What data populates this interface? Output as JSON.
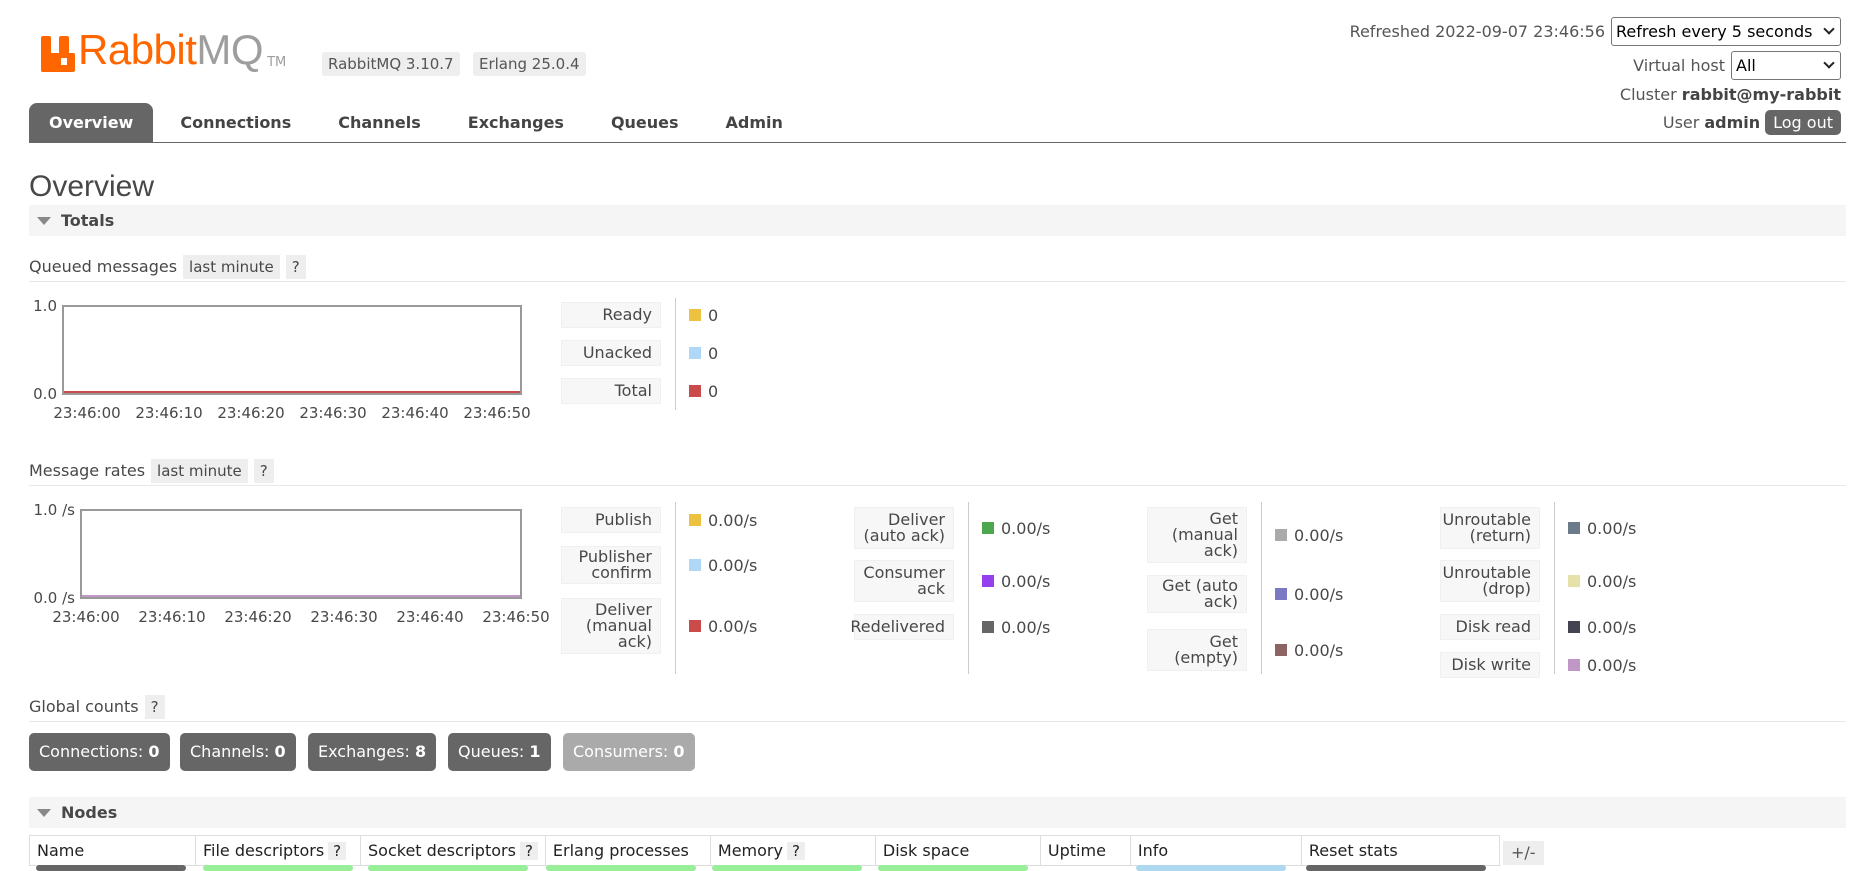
{
  "header": {
    "logo": {
      "brand": "Rabbit",
      "brand2": "MQ",
      "tm": "TM"
    },
    "rabbitmq_version": "RabbitMQ 3.10.7",
    "erlang_version": "Erlang 25.0.4",
    "refreshed_label": "Refreshed 2022-09-07 23:46:56",
    "refresh_select": "Refresh every 5 seconds",
    "vhost_label": "Virtual host",
    "vhost_select": "All",
    "cluster_label": "Cluster",
    "cluster_name": "rabbit@my-rabbit",
    "user_label": "User",
    "user_name": "admin",
    "logout_label": "Log out"
  },
  "tabs": [
    {
      "label": "Overview",
      "active": true
    },
    {
      "label": "Connections"
    },
    {
      "label": "Channels"
    },
    {
      "label": "Exchanges"
    },
    {
      "label": "Queues"
    },
    {
      "label": "Admin"
    }
  ],
  "page_title": "Overview",
  "totals": {
    "section_label": "Totals",
    "queued": {
      "title": "Queued messages",
      "range_label": "last minute",
      "help": "?",
      "series": [
        {
          "label": "Ready",
          "value": "0",
          "color": "#edc240"
        },
        {
          "label": "Unacked",
          "value": "0",
          "color": "#afd8f8"
        },
        {
          "label": "Total",
          "value": "0",
          "color": "#cb4b4b"
        }
      ]
    },
    "rates": {
      "title": "Message rates",
      "range_label": "last minute",
      "help": "?",
      "groups": [
        [
          {
            "label": "Publish",
            "value": "0.00/s",
            "color": "#edc240"
          },
          {
            "label": "Publisher confirm",
            "value": "0.00/s",
            "color": "#afd8f8"
          },
          {
            "label": "Deliver (manual ack)",
            "value": "0.00/s",
            "color": "#cb4b4b"
          }
        ],
        [
          {
            "label": "Deliver (auto ack)",
            "value": "0.00/s",
            "color": "#4da74d"
          },
          {
            "label": "Consumer ack",
            "value": "0.00/s",
            "color": "#9440ed"
          },
          {
            "label": "Redelivered",
            "value": "0.00/s",
            "color": "#666666"
          }
        ],
        [
          {
            "label": "Get (manual ack)",
            "value": "0.00/s",
            "color": "#aaaaaa"
          },
          {
            "label": "Get (auto ack)",
            "value": "0.00/s",
            "color": "#7c79c3"
          },
          {
            "label": "Get (empty)",
            "value": "0.00/s",
            "color": "#8d6363"
          }
        ],
        [
          {
            "label": "Unroutable (return)",
            "value": "0.00/s",
            "color": "#6b7b8b"
          },
          {
            "label": "Unroutable (drop)",
            "value": "0.00/s",
            "color": "#e4e2a8"
          },
          {
            "label": "Disk read",
            "value": "0.00/s",
            "color": "#444450"
          },
          {
            "label": "Disk write",
            "value": "0.00/s",
            "color": "#bf98c5"
          }
        ]
      ]
    },
    "global_counts": {
      "title": "Global counts",
      "help": "?",
      "items": [
        {
          "label": "Connections:",
          "value": "0"
        },
        {
          "label": "Channels:",
          "value": "0"
        },
        {
          "label": "Exchanges:",
          "value": "8"
        },
        {
          "label": "Queues:",
          "value": "1"
        },
        {
          "label": "Consumers:",
          "value": "0"
        }
      ]
    }
  },
  "chart_data": [
    {
      "type": "line",
      "x": [
        "23:46:00",
        "23:46:10",
        "23:46:20",
        "23:46:30",
        "23:46:40",
        "23:46:50"
      ],
      "series": [
        {
          "name": "Ready",
          "values": [
            0,
            0,
            0,
            0,
            0,
            0
          ]
        },
        {
          "name": "Unacked",
          "values": [
            0,
            0,
            0,
            0,
            0,
            0
          ]
        },
        {
          "name": "Total",
          "values": [
            0,
            0,
            0,
            0,
            0,
            0
          ]
        }
      ],
      "yticks": [
        "1.0",
        "0.0"
      ],
      "ylim": [
        0,
        1
      ]
    },
    {
      "type": "line",
      "x": [
        "23:46:00",
        "23:46:10",
        "23:46:20",
        "23:46:30",
        "23:46:40",
        "23:46:50"
      ],
      "series": [
        {
          "name": "Disk write",
          "values": [
            0,
            0,
            0,
            0,
            0,
            0
          ]
        }
      ],
      "yticks": [
        "1.0 /s",
        "0.0 /s"
      ],
      "ylim": [
        0,
        1
      ]
    }
  ],
  "nodes": {
    "section_label": "Nodes",
    "help": "?",
    "columns": [
      "Name",
      "File descriptors",
      "Socket descriptors",
      "Erlang processes",
      "Memory",
      "Disk space",
      "Uptime",
      "Info",
      "Reset stats"
    ],
    "plusminus": "+/-"
  }
}
